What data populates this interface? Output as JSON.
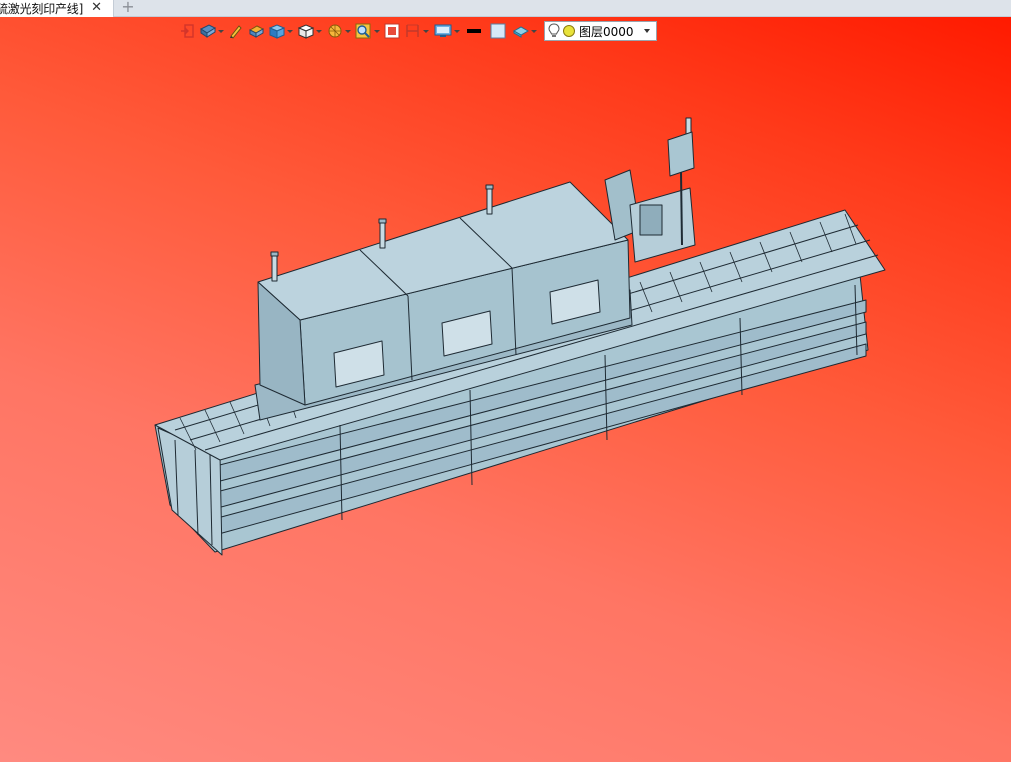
{
  "tab": {
    "title": "硫激光刻印产线]",
    "close_symbol": "✕",
    "add_symbol": "+"
  },
  "toolbar": {
    "buttons": [
      {
        "name": "exit-view-icon",
        "dropdown": false
      },
      {
        "name": "view-orientation-icon",
        "dropdown": true
      },
      {
        "name": "pen-icon",
        "dropdown": false
      },
      {
        "name": "section-icon",
        "dropdown": false
      },
      {
        "name": "render-mode-icon",
        "dropdown": true
      },
      {
        "name": "cube-view-icon",
        "dropdown": true
      },
      {
        "name": "lighting-icon",
        "dropdown": true
      },
      {
        "name": "zoom-icon",
        "dropdown": true
      },
      {
        "name": "fit-icon",
        "dropdown": false
      },
      {
        "name": "dimension-icon",
        "dropdown": true
      },
      {
        "name": "display-icon",
        "dropdown": true
      },
      {
        "name": "line-color-icon",
        "dropdown": false
      },
      {
        "name": "fill-color-icon",
        "dropdown": false
      },
      {
        "name": "layer-style-icon",
        "dropdown": true
      }
    ],
    "layer": {
      "value": "图层0000"
    }
  },
  "colors": {
    "viewport_top": "#ff1a00",
    "viewport_bottom": "#ff8a80",
    "model_fill": "#a9c6d2",
    "model_line": "#1e2a33"
  },
  "model": {
    "name": "laser-engraving-production-line"
  }
}
